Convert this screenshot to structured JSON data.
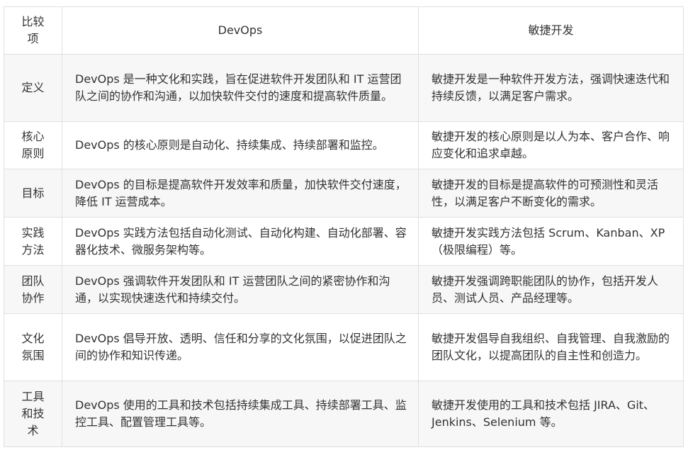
{
  "table": {
    "headers": [
      "比较项",
      "DevOps",
      "敏捷开发"
    ],
    "rows": [
      [
        "定义",
        "DevOps 是一种文化和实践，旨在促进软件开发团队和 IT 运营团队之间的协作和沟通，以加快软件交付的速度和提高软件质量。",
        "敏捷开发是一种软件开发方法，强调快速迭代和持续反馈，以满足客户需求。"
      ],
      [
        "核心原则",
        "DevOps 的核心原则是自动化、持续集成、持续部署和监控。",
        "敏捷开发的核心原则是以人为本、客户合作、响应变化和追求卓越。"
      ],
      [
        "目标",
        "DevOps 的目标是提高软件开发效率和质量，加快软件交付速度，降低 IT 运营成本。",
        "敏捷开发的目标是提高软件的可预测性和灵活性，以满足客户不断变化的需求。"
      ],
      [
        "实践方法",
        "DevOps 实践方法包括自动化测试、自动化构建、自动化部署、容器化技术、微服务架构等。",
        "敏捷开发实践方法包括 Scrum、Kanban、XP（极限编程）等。"
      ],
      [
        "团队协作",
        "DevOps 强调软件开发团队和 IT 运营团队之间的紧密协作和沟通，以实现快速迭代和持续交付。",
        "敏捷开发强调跨职能团队的协作，包括开发人员、测试人员、产品经理等。"
      ],
      [
        "文化氛围",
        "DevOps 倡导开放、透明、信任和分享的文化氛围，以促进团队之间的协作和知识传递。",
        "敏捷开发倡导自我组织、自我管理、自我激励的团队文化，以提高团队的自主性和创造力。"
      ],
      [
        "工具和技术",
        "DevOps 使用的工具和技术包括持续集成工具、持续部署工具、监控工具、配置管理工具等。",
        "敏捷开发使用的工具和技术包括 JIRA、Git、Jenkins、Selenium 等。"
      ]
    ]
  }
}
